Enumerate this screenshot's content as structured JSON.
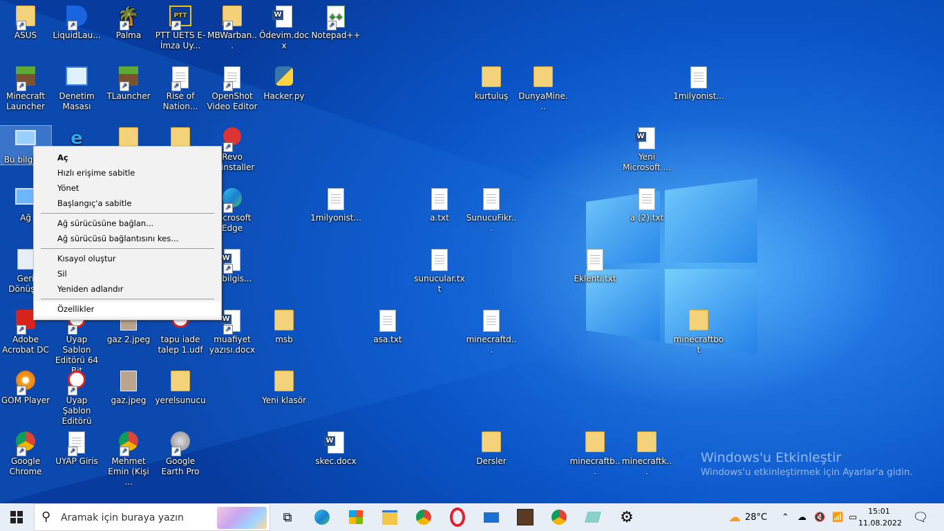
{
  "desktop_icons": {
    "asus": "ASUS",
    "liquidlauncher": "LiquidLau...",
    "palma": "Palma",
    "pttuets": "PTT UETS E-İmza Uy...",
    "mbwarband": "MBWarban...",
    "odevim": "Ödevim.docx",
    "notepadpp": "Notepad++",
    "minecraft_launcher": "Minecraft Launcher",
    "denetim": "Denetim Masası",
    "tlauncher": "TLauncher",
    "rise": "Rise of Nation...",
    "openshot": "OpenShot Video Editor",
    "hacker": "Hacker.py",
    "kurtulus": "kurtuluş",
    "dunyamine": "DunyaMine...",
    "milyonist_top": "1milyonist...",
    "bubilgisayar": "Bu bilgis...",
    "revo": "Revo Uninstaller",
    "yeni_microsoft": "Yeni Microsoft ...",
    "ag": "Ağ",
    "edge": "Microsoft Edge",
    "milyonist_mid": "1milyonist...",
    "a_txt": "a.txt",
    "sunucufikr": "SunucuFikr...",
    "a2_txt": "a (2).txt",
    "geri": "Geri Dönüş...",
    "ilkbilgis": "ilkbilgis...",
    "sunucular": "sunucular.txt",
    "eklenti": "Eklenti.txt",
    "adobe": "Adobe Acrobat DC",
    "uyap64": "Uyap Sablon Editörü 64 Bit",
    "gaz2": "gaz 2.jpeg",
    "tapu": "tapu iade talep 1.udf",
    "muafiyet": "muafiyet yazısı.docx",
    "msb": "msb",
    "asa": "asa.txt",
    "minecraftd": "minecraftd...",
    "minecraftbot": "minecraftbot",
    "gom": "GOM Player",
    "uyap_sablon": "Uyap Şablon Editörü",
    "gaz": "gaz.jpeg",
    "yerelsunucu": "yerelsunucu",
    "yeni_klasor": "Yeni klasör",
    "chrome": "Google Chrome",
    "uyap_giris": "UYAP Giris",
    "mehmet": "Mehmet Emin (Kişi ...",
    "earth": "Google Earth Pro",
    "skec": "skec.docx",
    "dersler": "Dersler",
    "minecraftb": "minecraftb...",
    "minecraftk": "minecraftk..."
  },
  "context_menu": {
    "open": "Aç",
    "pin_quick": "Hızlı erişime sabitle",
    "manage": "Yönet",
    "pin_start": "Başlangıç'a sabitle",
    "map_drive": "Ağ sürücüsüne bağlan...",
    "disconnect_drive": "Ağ sürücüsü bağlantısını kes...",
    "create_shortcut": "Kısayol oluştur",
    "delete": "Sil",
    "rename": "Yeniden adlandır",
    "properties": "Özellikler"
  },
  "watermark": {
    "title": "Windows'u Etkinleştir",
    "subtitle": "Windows'u etkinleştirmek için Ayarlar'a gidin."
  },
  "taskbar": {
    "search_placeholder": "Aramak için buraya yazın",
    "weather": "28°C",
    "time": "15:01",
    "date": "11.08.2022"
  }
}
